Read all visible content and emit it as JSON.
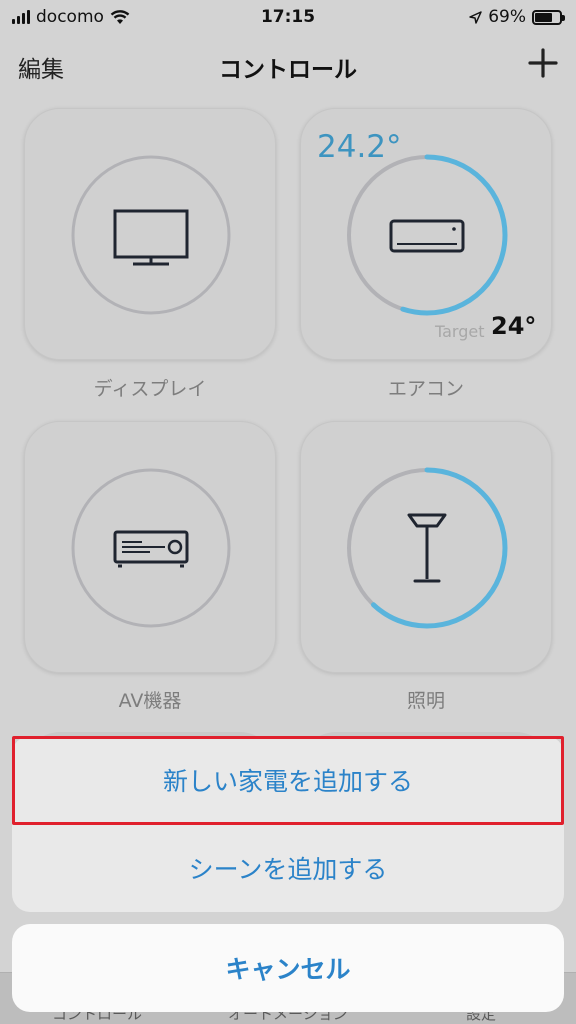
{
  "status_bar": {
    "carrier": "docomo",
    "time": "17:15",
    "battery": "69%",
    "battery_level": 0.69
  },
  "nav": {
    "edit_label": "編集",
    "title": "コントロール",
    "add_icon": "plus-icon"
  },
  "devices": [
    {
      "label": "ディスプレイ",
      "icon": "tv-icon"
    },
    {
      "label": "エアコン",
      "icon": "air-conditioner-icon",
      "current_temp": "24.2°",
      "target_label": "Target",
      "target_temp": "24°",
      "level": 0.55
    },
    {
      "label": "AV機器",
      "icon": "av-receiver-icon"
    },
    {
      "label": "照明",
      "icon": "floor-lamp-icon",
      "level": 0.62
    }
  ],
  "action_sheet": {
    "items": [
      {
        "label": "新しい家電を追加する"
      },
      {
        "label": "シーンを追加する"
      }
    ],
    "cancel_label": "キャンセル"
  },
  "tab_bar": {
    "items": [
      {
        "label": "コントロール"
      },
      {
        "label": "オートメーション"
      },
      {
        "label": "設定"
      }
    ]
  },
  "colors": {
    "accent": "#2b83c9",
    "ring_active": "#5ab4dc",
    "ring_track": "#b2b2b6",
    "highlight": "#e0202d"
  }
}
